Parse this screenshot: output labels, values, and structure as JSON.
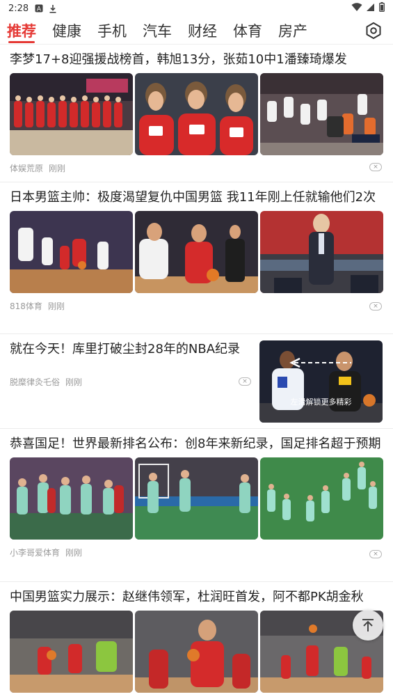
{
  "status_bar": {
    "time": "2:28",
    "icons": [
      "notification-a-icon",
      "download-icon",
      "wifi-icon",
      "signal-icon",
      "battery-icon"
    ]
  },
  "tabs": [
    {
      "label": "推荐",
      "active": true
    },
    {
      "label": "健康",
      "active": false
    },
    {
      "label": "手机",
      "active": false
    },
    {
      "label": "汽车",
      "active": false
    },
    {
      "label": "财经",
      "active": false
    },
    {
      "label": "体育",
      "active": false
    },
    {
      "label": "房产",
      "active": false
    }
  ],
  "settings_icon": "hexagon-settings-icon",
  "accent_color": "#e53935",
  "articles": [
    {
      "title": "李梦17+8迎强援战榜首，韩旭13分，张茹10中1潘臻琦爆发",
      "source": "体娱荒原",
      "time": "刚刚",
      "image_captions": [
        "",
        "",
        ""
      ]
    },
    {
      "title": "日本男篮主帅：极度渴望复仇中国男篮 我11年刚上任就输他们2次",
      "source": "818体育",
      "time": "刚刚",
      "image_captions": [
        "",
        "",
        ""
      ]
    },
    {
      "title": "就在今天！库里打破尘封28年的NBA纪录",
      "source": "脱糜律灸乇俗",
      "time": "刚刚",
      "image_overlay_text": "左滑解锁更多精彩"
    },
    {
      "title": "恭喜国足！世界最新排名公布：创8年来新纪录，国足排名超于预期",
      "source": "小李哥爱体育",
      "time": "刚刚",
      "image_captions": [
        "",
        "",
        ""
      ]
    },
    {
      "title": "中国男篮实力展示：赵继伟领军，杜润旺首发，阿不都PK胡金秋",
      "source": "",
      "time": "",
      "image_captions": [
        "",
        "",
        ""
      ]
    }
  ],
  "close_symbol": "×",
  "back_to_top_icon": "arrow-up-to-top-icon"
}
